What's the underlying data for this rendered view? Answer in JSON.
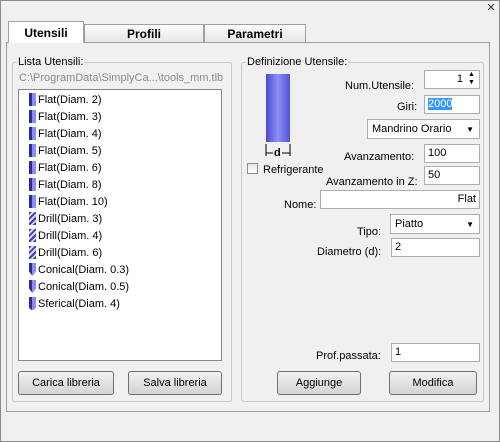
{
  "window": {
    "close_glyph": "✕"
  },
  "tabs": [
    {
      "label": "Utensili",
      "active": true
    },
    {
      "label": "Profili",
      "active": false
    },
    {
      "label": "Parametri",
      "active": false
    }
  ],
  "library": {
    "group_label": "Lista Utensili:",
    "path": "C:\\ProgramData\\SimplyCa...\\tools_mm.tlb",
    "items": [
      {
        "label": "Flat(Diam. 2)",
        "icon": "flat-end-mill-icon"
      },
      {
        "label": "Flat(Diam. 3)",
        "icon": "flat-end-mill-icon"
      },
      {
        "label": "Flat(Diam. 4)",
        "icon": "flat-end-mill-icon"
      },
      {
        "label": "Flat(Diam. 5)",
        "icon": "flat-end-mill-icon"
      },
      {
        "label": "Flat(Diam. 6)",
        "icon": "flat-end-mill-icon"
      },
      {
        "label": "Flat(Diam. 8)",
        "icon": "flat-end-mill-icon"
      },
      {
        "label": "Flat(Diam. 10)",
        "icon": "flat-end-mill-icon"
      },
      {
        "label": "Drill(Diam. 3)",
        "icon": "drill-icon"
      },
      {
        "label": "Drill(Diam. 4)",
        "icon": "drill-icon"
      },
      {
        "label": "Drill(Diam. 6)",
        "icon": "drill-icon"
      },
      {
        "label": "Conical(Diam. 0.3)",
        "icon": "conical-tool-icon"
      },
      {
        "label": "Conical(Diam. 0.5)",
        "icon": "conical-tool-icon"
      },
      {
        "label": "Sferical(Diam. 4)",
        "icon": "spherical-tool-icon"
      }
    ],
    "load_button": "Carica libreria",
    "save_button": "Salva libreria"
  },
  "definition": {
    "group_label": "Definizione Utensile:",
    "diagram_label": "d",
    "num_label": "Num.Utensile:",
    "num_value": "1",
    "giri_label": "Giri:",
    "giri_value": "2000",
    "spindle_value": "Mandrino Orario",
    "feed_label": "Avanzamento:",
    "feed_value": "100",
    "coolant_label": "Refrigerante",
    "coolant_checked": false,
    "feedz_label": "Avanzamento in Z:",
    "feedz_value": "50",
    "name_label": "Nome:",
    "name_value": "Flat",
    "type_label": "Tipo:",
    "type_value": "Piatto",
    "diameter_label": "Diametro (d):",
    "diameter_value": "2",
    "depth_label": "Prof.passata:",
    "depth_value": "1",
    "add_button": "Aggiunge",
    "edit_button": "Modifica"
  },
  "colors": {
    "tool_blue": "#6a6ae8",
    "selection": "#3399ff"
  }
}
